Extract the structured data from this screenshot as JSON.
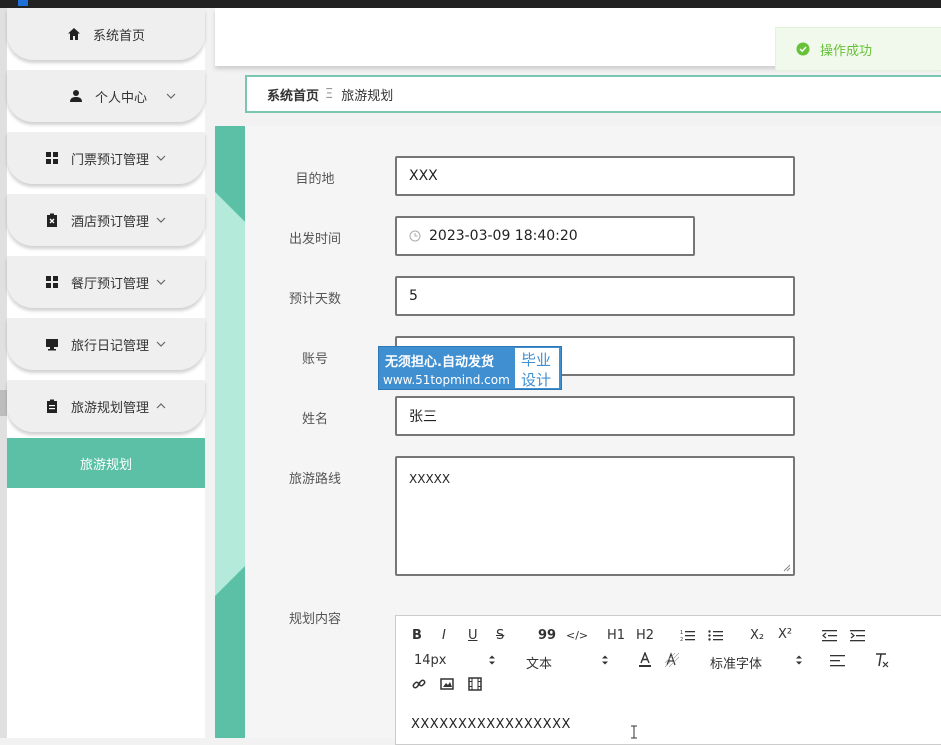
{
  "sidebar": {
    "items": [
      {
        "label": "系统首页",
        "icon": "home-icon"
      },
      {
        "label": "个人中心",
        "icon": "user-icon"
      },
      {
        "label": "门票预订管理",
        "icon": "grid-icon"
      },
      {
        "label": "酒店预订管理",
        "icon": "clipboard-x-icon"
      },
      {
        "label": "餐厅预订管理",
        "icon": "grid-icon"
      },
      {
        "label": "旅行日记管理",
        "icon": "monitor-icon"
      },
      {
        "label": "旅游规划管理",
        "icon": "clipboard-icon"
      }
    ],
    "submenu": {
      "label": "旅游规划"
    }
  },
  "breadcrumb": {
    "home": "系统首页",
    "separator": "Ξ",
    "current": "旅游规划"
  },
  "toast": {
    "message": "操作成功",
    "icon": "check-circle-icon",
    "color": "#67c23a"
  },
  "form": {
    "destination": {
      "label": "目的地",
      "value": "XXX"
    },
    "depart_time": {
      "label": "出发时间",
      "value": "2023-03-09 18:40:20",
      "icon": "clock-icon"
    },
    "days": {
      "label": "预计天数",
      "value": "5"
    },
    "account": {
      "label": "账号",
      "value": ""
    },
    "name": {
      "label": "姓名",
      "value": "张三"
    },
    "route": {
      "label": "旅游路线",
      "value": "XXXXX"
    },
    "plan": {
      "label": "规划内容"
    }
  },
  "editor": {
    "toolbar": {
      "bold": "B",
      "italic": "I",
      "underline": "U",
      "strike": "S",
      "quote": "99",
      "code": "</>",
      "h1": "H1",
      "h2": "H2",
      "subscript": "X₂",
      "superscript": "X²",
      "size": "14px",
      "header": "文本",
      "font": "标准字体"
    },
    "content": "XXXXXXXXXXXXXXXXX"
  },
  "watermark": {
    "line1": "无须担心.自动发货",
    "line2": "www.51topmind.com",
    "right1": "毕业",
    "right2": "设计"
  },
  "colors": {
    "accent": "#5bc0a6",
    "breadcrumb_border": "#79c7b1",
    "toast_bg": "#f0f9eb"
  }
}
